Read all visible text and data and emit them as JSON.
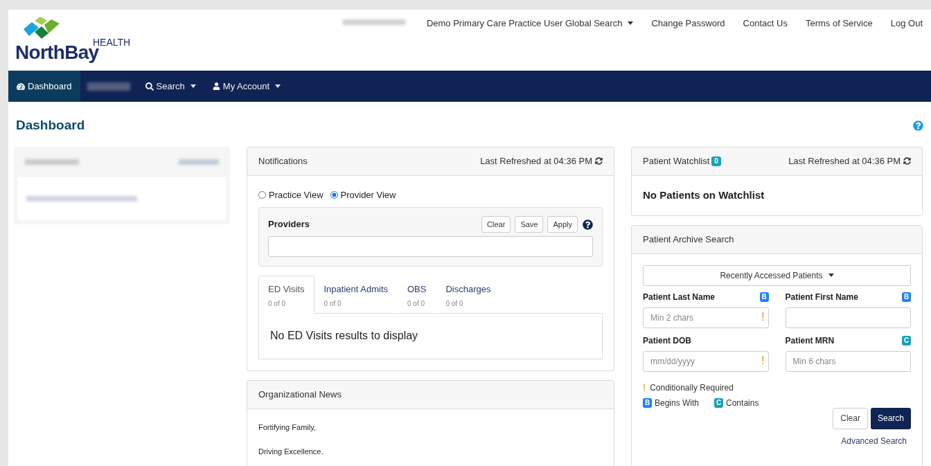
{
  "header": {
    "logo": {
      "small": "HEALTH",
      "name": "NorthBay"
    },
    "top_links": [
      {
        "label": "Demo Primary Care Practice User Global Search",
        "dropdown": true
      },
      {
        "label": "Change Password",
        "dropdown": false
      },
      {
        "label": "Contact Us",
        "dropdown": false
      },
      {
        "label": "Terms of Service",
        "dropdown": false
      },
      {
        "label": "Log Out",
        "dropdown": false
      }
    ]
  },
  "nav": {
    "items": [
      {
        "label": "Dashboard",
        "kind": "dashboard",
        "selected": true,
        "dropdown": false
      },
      {
        "kind": "redacted"
      },
      {
        "label": "Search",
        "kind": "search",
        "selected": false,
        "dropdown": true
      },
      {
        "label": "My Account",
        "kind": "account",
        "selected": false,
        "dropdown": true
      }
    ]
  },
  "page_title": "Dashboard",
  "notifications": {
    "title": "Notifications",
    "refreshed": "Last Refreshed at 04:36 PM",
    "views": [
      {
        "label": "Practice View",
        "selected": false
      },
      {
        "label": "Provider View",
        "selected": true
      }
    ],
    "providers": {
      "label": "Providers",
      "buttons": [
        "Clear",
        "Save",
        "Apply"
      ]
    },
    "tabs": [
      {
        "label": "ED Visits",
        "count": "0 of 0",
        "selected": true
      },
      {
        "label": "Inpatient Admits",
        "count": "0 of 0",
        "selected": false
      },
      {
        "label": "OBS",
        "count": "0 of 0",
        "selected": false
      },
      {
        "label": "Discharges",
        "count": "0 of 0",
        "selected": false
      }
    ],
    "empty_message": "No ED Visits results to display"
  },
  "org_news": {
    "title": "Organizational News",
    "lines": [
      "Fortifying Family,",
      "Driving Excellence."
    ]
  },
  "watchlist": {
    "title": "Patient Watchlist",
    "count": "0",
    "refreshed": "Last Refreshed at 04:36 PM",
    "empty_message": "No Patients on Watchlist"
  },
  "archive": {
    "title": "Patient Archive Search",
    "recent_button": "Recently Accessed Patients",
    "fields": [
      {
        "label": "Patient Last Name",
        "placeholder": "Min 2 chars",
        "badge": {
          "letter": "B",
          "kind": "begins"
        },
        "required": true
      },
      {
        "label": "Patient First Name",
        "badge": {
          "letter": "B",
          "kind": "begins"
        },
        "required": false
      },
      {
        "label": "Patient DOB",
        "placeholder": "mm/dd/yyyy",
        "required": true
      },
      {
        "label": "Patient MRN",
        "placeholder": "Min 6 chars",
        "badge": {
          "letter": "C",
          "kind": "contains"
        },
        "required": false
      }
    ],
    "legend": {
      "required_mark": "!",
      "required_text": "Conditionally Required",
      "badges": [
        {
          "letter": "B",
          "kind": "begins",
          "label": "Begins With"
        },
        {
          "letter": "C",
          "kind": "contains",
          "label": "Contains"
        }
      ]
    },
    "buttons": [
      {
        "label": "Clear",
        "kind": "secondary"
      },
      {
        "label": "Search",
        "kind": "primary"
      }
    ],
    "advanced_link": "Advanced Search"
  }
}
